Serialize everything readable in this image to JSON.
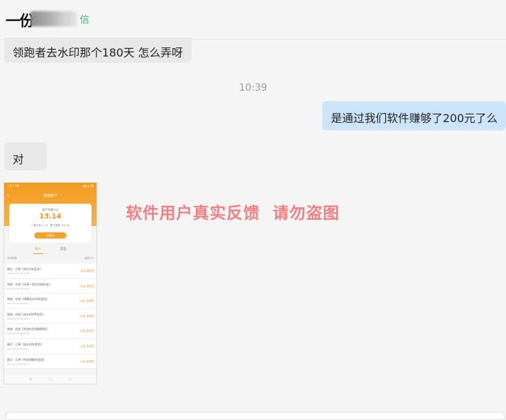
{
  "header": {
    "title_visible": "一份",
    "title_suffix": "信"
  },
  "messages": [
    {
      "side": "in",
      "text": "领跑者去水印那个180天 怎么弄呀"
    },
    {
      "side": "out",
      "text": "是通过我们软件赚够了200元了么"
    },
    {
      "side": "in",
      "text": "对"
    }
  ],
  "timestamp": "10:39",
  "watermark": "软件用户真实反馈  请勿盗图",
  "screenshot": {
    "status_time": "上午1:58",
    "status_right": "▮▮ ◔ 49",
    "back": "‹",
    "nav_title": "现金账户",
    "card_label": "账户余额(元)",
    "amount": "13.14",
    "stats": "• 累计收入  1.6 ·  累计提现  204.16",
    "withdraw_label": "去提现",
    "tab_income": "收入",
    "tab_withdraw": "支出",
    "list_left": "收益明细",
    "list_right": "金额(元)",
    "rows": [
      {
        "title": "高亿 · 订单《米忆1年会员》",
        "date": "2023-07-17 08:12:28",
        "amount": "+0.00元"
      },
      {
        "title": "完成 · 外卖《分享一份红包给好友》",
        "date": "2023-07-17 08:12:58",
        "amount": "+2.30元"
      },
      {
        "title": "完成 · 任务《领跑去水印年会员》",
        "date": "2023-07-17 08:09:27",
        "amount": "+0.14元"
      },
      {
        "title": "完成 · 任务《去水印VIP会员》",
        "date": "2023-07-17 08:08:14",
        "amount": "+0.14元"
      },
      {
        "title": "完成 · 任务《外卖红包领取提现》",
        "date": "2023-07-16 18:47:40",
        "amount": "+0.14元"
      },
      {
        "title": "高亿 · 订单《去水印年会员》",
        "date": "2023-07-17 08:06:17",
        "amount": "+0.14元"
      },
      {
        "title": "高亿 · 订单《外卖领取年会员》",
        "date": "2023-07-17 08:05:17",
        "amount": "+0.14元"
      }
    ],
    "bottom_icons": [
      "≡",
      "□",
      "◁"
    ]
  }
}
